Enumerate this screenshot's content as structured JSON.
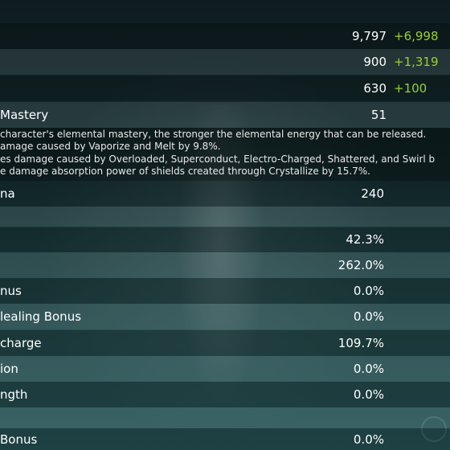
{
  "stats": [
    {
      "label": "",
      "value": "9,797",
      "bonus": "+6,998"
    },
    {
      "label": "",
      "value": "900",
      "bonus": "+1,319"
    },
    {
      "label": "",
      "value": "630",
      "bonus": "+100"
    },
    {
      "label": "Mastery",
      "value": "51",
      "bonus": ""
    }
  ],
  "mastery_description": [
    "character's elemental mastery, the stronger the elemental energy that can be released.",
    "amage caused by Vaporize and Melt by 9.8%.",
    "es damage caused by Overloaded, Superconduct, Electro-Charged, Shattered, and Swirl b",
    "e damage absorption power of shields created through Crystallize by 15.7%."
  ],
  "advanced": [
    {
      "label": "na",
      "value": "240"
    },
    {
      "label": "",
      "value": ""
    },
    {
      "label": "",
      "value": "42.3%"
    },
    {
      "label": "",
      "value": "262.0%"
    },
    {
      "label": "nus",
      "value": "0.0%"
    },
    {
      "label": "lealing Bonus",
      "value": "0.0%"
    },
    {
      "label": "charge",
      "value": "109.7%"
    },
    {
      "label": "ion",
      "value": "0.0%"
    },
    {
      "label": "ngth",
      "value": "0.0%"
    },
    {
      "label": "",
      "value": ""
    },
    {
      "label": "Bonus",
      "value": "0.0%"
    }
  ]
}
